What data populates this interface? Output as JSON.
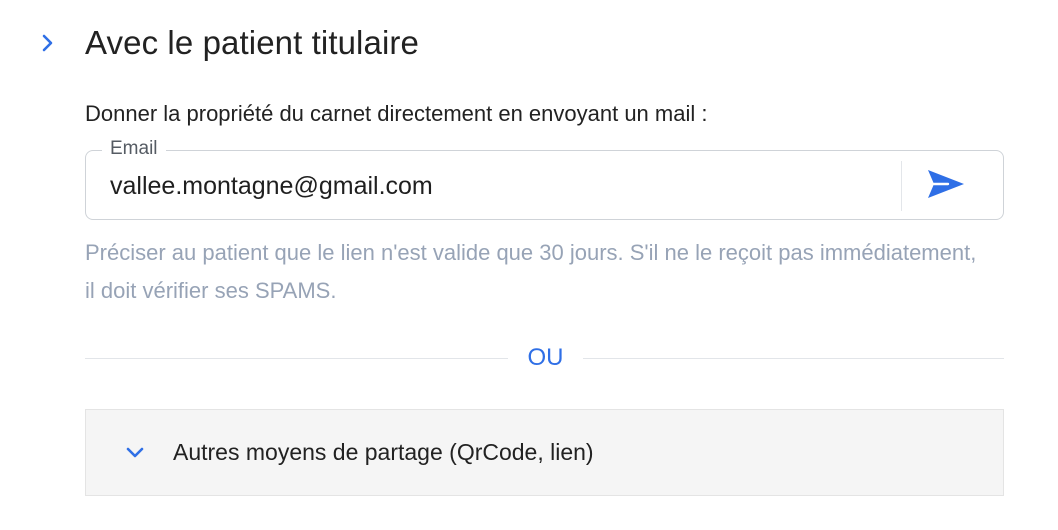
{
  "section": {
    "title": "Avec le patient titulaire",
    "expand_icon": "chevron-right-icon"
  },
  "intro": {
    "text": "Donner la propriété du carnet directement en envoyant un mail :"
  },
  "email_field": {
    "label": "Email",
    "value": "vallee.montagne@gmail.com",
    "send_icon": "send-icon"
  },
  "helper": {
    "text": "Préciser au patient que le lien n'est valide que 30 jours. S'il ne le reçoit pas immédiatement, il doit vérifier ses SPAMS."
  },
  "separator": {
    "label": "OU"
  },
  "accordion": {
    "label": "Autres moyens de partage (QrCode, lien)",
    "icon": "chevron-down-icon"
  },
  "colors": {
    "accent": "#2f6fe6",
    "helper_text": "#97a3b6",
    "accordion_bg": "#f5f5f5"
  }
}
